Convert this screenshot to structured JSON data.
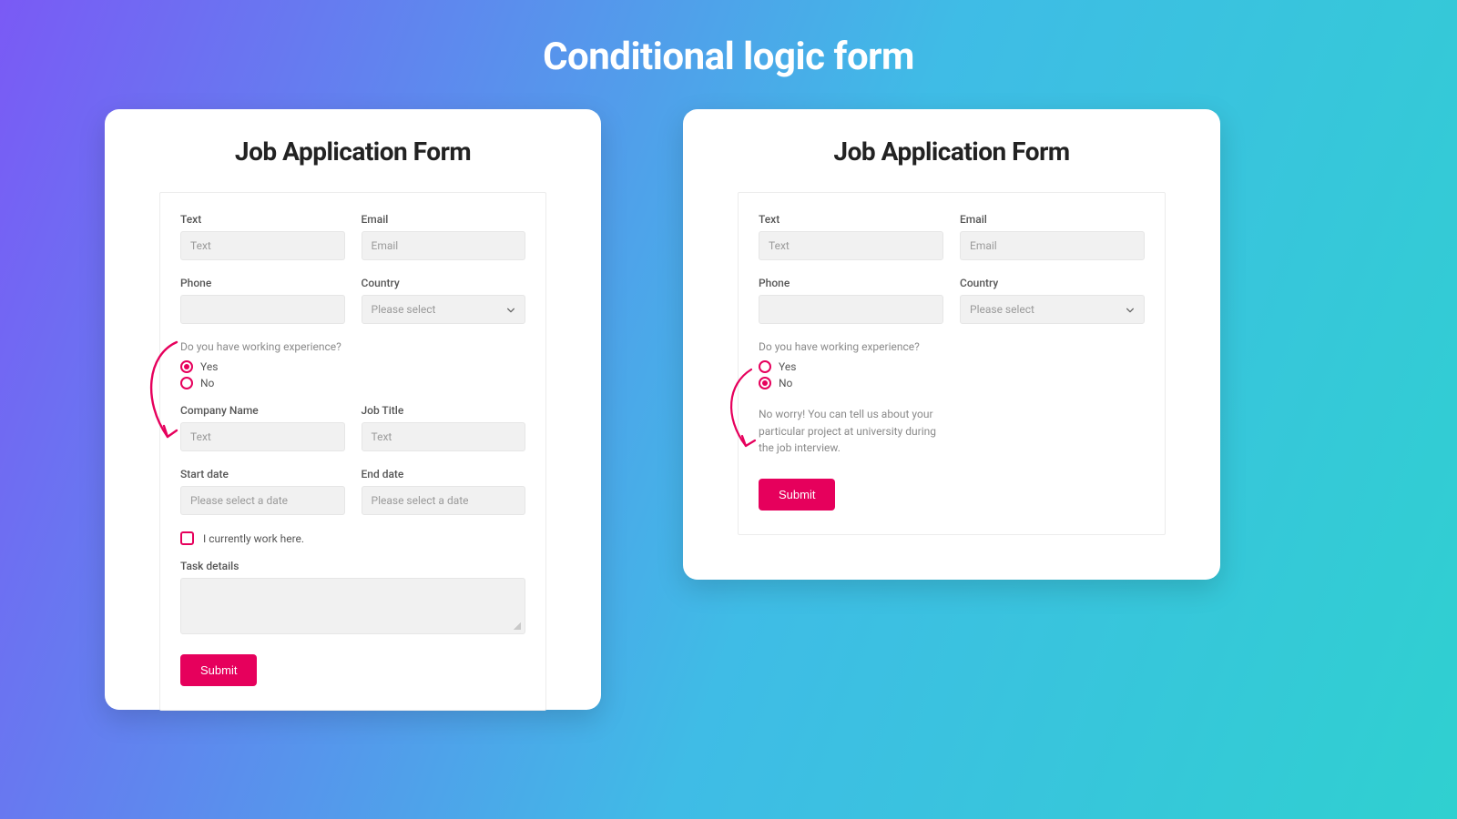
{
  "pageTitle": "Conditional logic form",
  "leftCard": {
    "heading": "Job Application Form",
    "fields": {
      "textLabel": "Text",
      "textPlaceholder": "Text",
      "emailLabel": "Email",
      "emailPlaceholder": "Email",
      "phoneLabel": "Phone",
      "countryLabel": "Country",
      "countryPlaceholder": "Please select",
      "question": "Do you have working experience?",
      "optYes": "Yes",
      "optNo": "No",
      "companyLabel": "Company Name",
      "companyPlaceholder": "Text",
      "jobTitleLabel": "Job Title",
      "jobTitlePlaceholder": "Text",
      "startDateLabel": "Start date",
      "startDatePlaceholder": "Please select a date",
      "endDateLabel": "End date",
      "endDatePlaceholder": "Please select a date",
      "currentlyWork": "I currently work here.",
      "taskDetailsLabel": "Task details",
      "submit": "Submit"
    }
  },
  "rightCard": {
    "heading": "Job Application Form",
    "fields": {
      "textLabel": "Text",
      "textPlaceholder": "Text",
      "emailLabel": "Email",
      "emailPlaceholder": "Email",
      "phoneLabel": "Phone",
      "countryLabel": "Country",
      "countryPlaceholder": "Please select",
      "question": "Do you have working experience?",
      "optYes": "Yes",
      "optNo": "No",
      "infoText": "No worry! You can tell us about your particular project at university during the job interview.",
      "submit": "Submit"
    }
  },
  "colors": {
    "accent": "#e6005c"
  }
}
